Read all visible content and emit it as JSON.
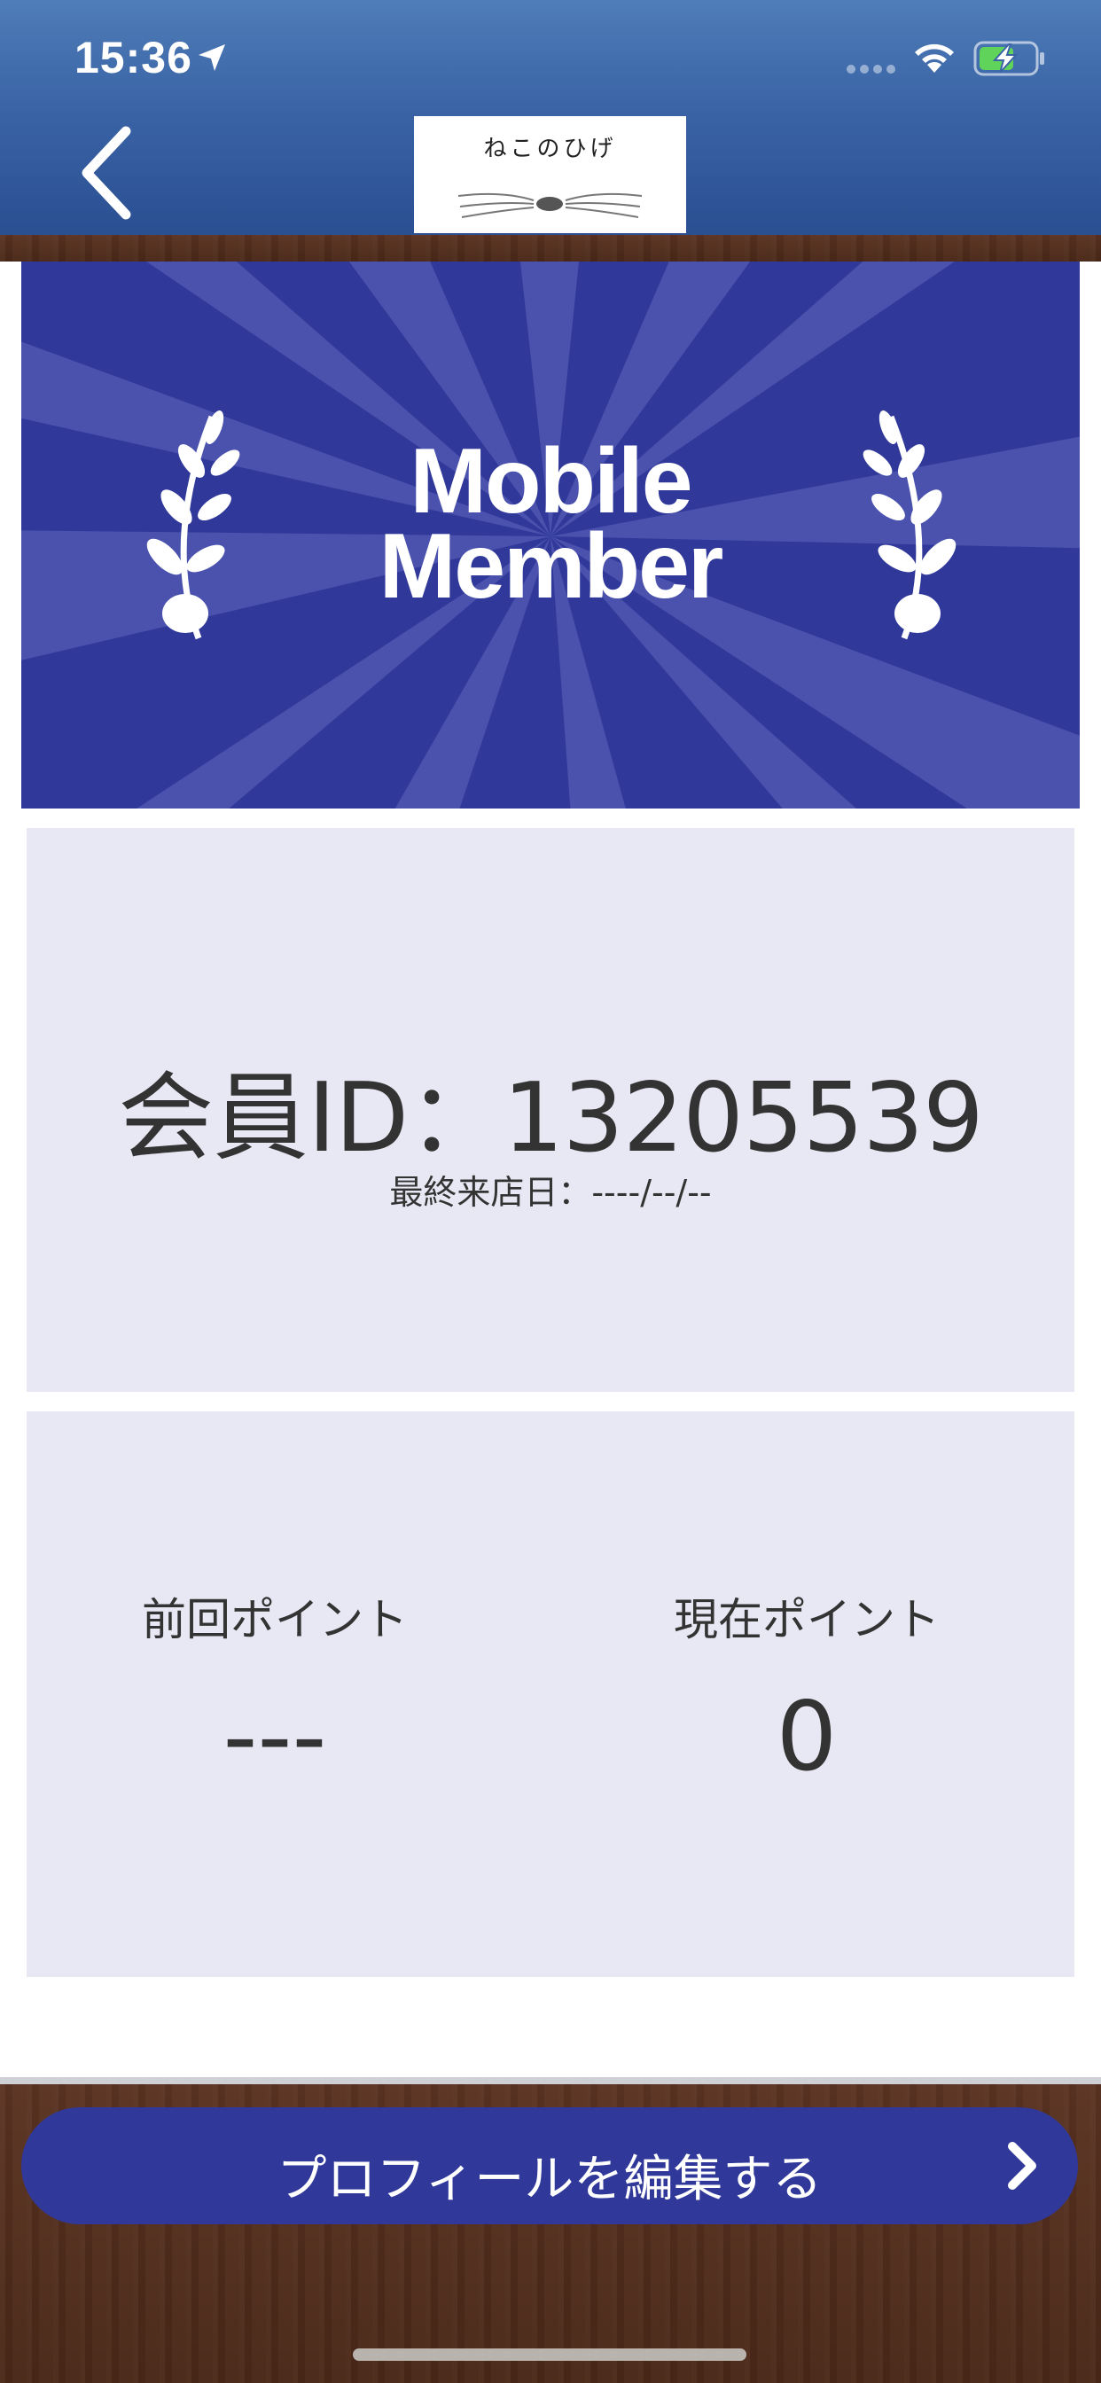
{
  "status_bar": {
    "time": "15:36",
    "icons": [
      "location-arrow-icon",
      "signal-icon",
      "wifi-icon",
      "battery-charging-icon"
    ]
  },
  "header": {
    "back_icon": "chevron-left-icon",
    "logo_text": "ねこのひげ"
  },
  "banner": {
    "title_line1": "Mobile",
    "title_line2": "Member"
  },
  "member": {
    "id_text": "会員ID：13205539",
    "last_visit": "最終来店日：----/--/--"
  },
  "points": {
    "previous_label": "前回ポイント",
    "previous_value": "---",
    "current_label": "現在ポイント",
    "current_value": "0"
  },
  "footer": {
    "edit_profile_label": "プロフィールを編集する"
  },
  "colors": {
    "header_blue": "#3a64a6",
    "banner_navy": "#30399a",
    "card_bg": "#e8e8f4",
    "wood_brown": "#4a2818",
    "text_dark": "#333333"
  }
}
